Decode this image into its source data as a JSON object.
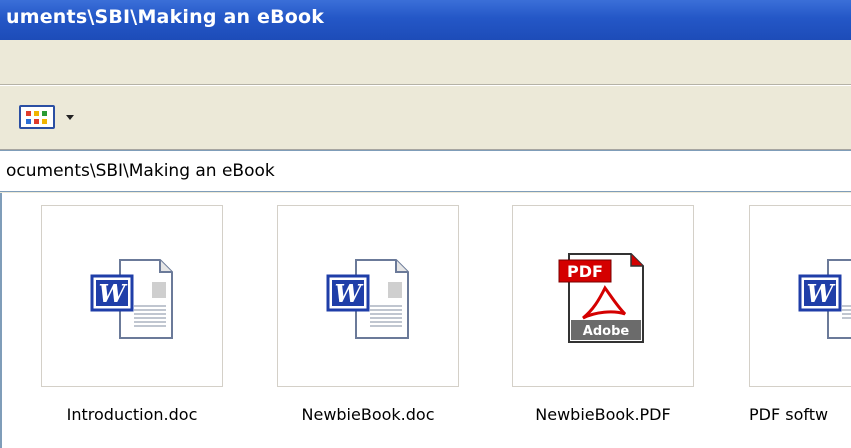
{
  "window": {
    "title": "uments\\SBI\\Making an eBook"
  },
  "toolbar": {
    "views_icon": "views-icon",
    "dropdown_icon": "chevron-down-icon"
  },
  "address": {
    "path": "ocuments\\SBI\\Making an eBook"
  },
  "files": [
    {
      "name": "Introduction.doc",
      "icon": "word-document-icon"
    },
    {
      "name": "NewbieBook.doc",
      "icon": "word-document-icon"
    },
    {
      "name": "NewbieBook.PDF",
      "icon": "pdf-document-icon",
      "badge": "PDF",
      "footer": "Adobe"
    },
    {
      "name": "PDF softw",
      "icon": "word-document-icon"
    }
  ],
  "colors": {
    "titlebar": "#2457c7",
    "word_blue": "#1f3ea8",
    "pdf_red": "#d40000"
  }
}
